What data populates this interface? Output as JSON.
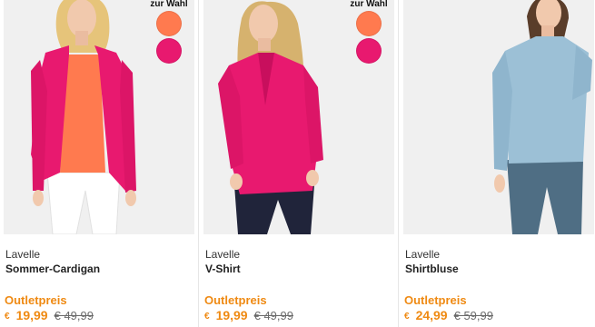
{
  "products": [
    {
      "brand": "Lavelle",
      "name": "Sommer-Cardigan",
      "outlet_label": "Outletpreis",
      "currency": "€",
      "price": "19,99",
      "old_price": "€ 49,99",
      "swatch_label": "zur Wahl",
      "swatches": [
        "#ff7a4f",
        "#e8196f"
      ]
    },
    {
      "brand": "Lavelle",
      "name": "V-Shirt",
      "outlet_label": "Outletpreis",
      "currency": "€",
      "price": "19,99",
      "old_price": "€ 49,99",
      "swatch_label": "zur Wahl",
      "swatches": [
        "#ff7a4f",
        "#e8196f"
      ]
    },
    {
      "brand": "Lavelle",
      "name": "Shirtbluse",
      "outlet_label": "Outletpreis",
      "currency": "€",
      "price": "24,99",
      "old_price": "€ 59,99"
    }
  ],
  "colors": {
    "accent_orange": "#ef8a13",
    "cardigan_pink": "#e8196f",
    "top_orange": "#ff7a4f",
    "blouse_blue": "#9cc0d6",
    "pants_blue": "#4f6e84"
  }
}
